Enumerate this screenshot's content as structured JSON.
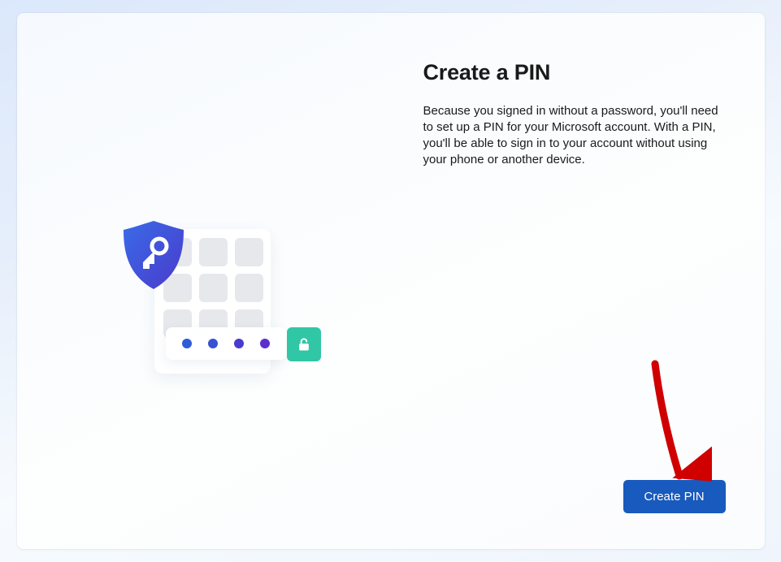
{
  "dialog": {
    "title": "Create a PIN",
    "body": "Because you signed in without a password, you'll need to set up a PIN for your Microsoft account. With a PIN, you'll be able to sign in to your account without using your phone or another device.",
    "primary_button": "Create PIN"
  },
  "illustration": {
    "shield_icon": "shield-key",
    "lock_icon": "unlock",
    "keypad_cells": 9,
    "pin_dots": 4
  },
  "annotation": {
    "type": "arrow",
    "color": "#d00000"
  }
}
